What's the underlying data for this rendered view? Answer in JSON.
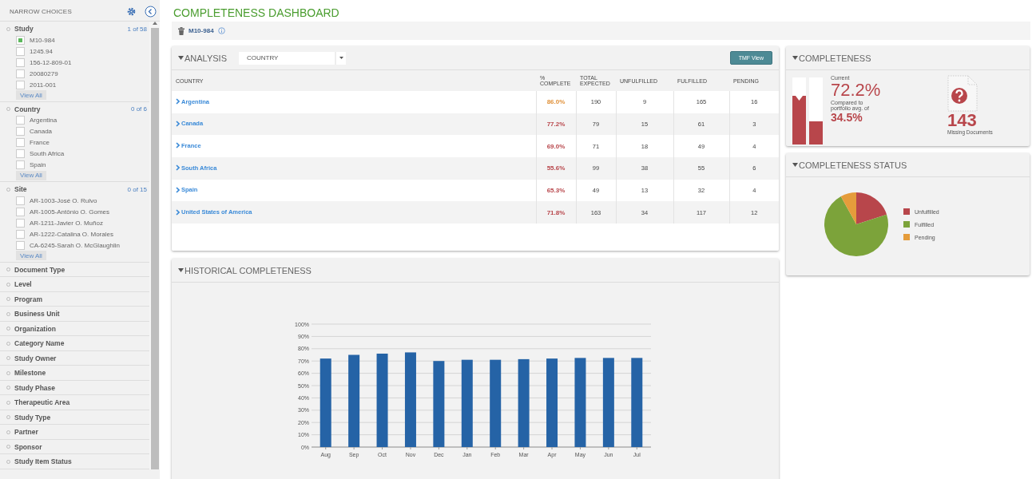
{
  "sidebar": {
    "title": "NARROW CHOICES",
    "facets": [
      {
        "name": "Study",
        "count": "1 of 58",
        "view_all": "View All",
        "items": [
          {
            "label": "M10-984",
            "checked": true
          },
          {
            "label": "1245.94",
            "checked": false
          },
          {
            "label": "156-12-809-01",
            "checked": false
          },
          {
            "label": "20080279",
            "checked": false
          },
          {
            "label": "2011-001",
            "checked": false
          }
        ]
      },
      {
        "name": "Country",
        "count": "0 of 6",
        "view_all": "View All",
        "items": [
          {
            "label": "Argentina",
            "checked": false
          },
          {
            "label": "Canada",
            "checked": false
          },
          {
            "label": "France",
            "checked": false
          },
          {
            "label": "South Africa",
            "checked": false
          },
          {
            "label": "Spain",
            "checked": false
          }
        ]
      },
      {
        "name": "Site",
        "count": "0 of 15",
        "view_all": "View All",
        "items": [
          {
            "label": "AR-1003-José O. Rulvo",
            "checked": false
          },
          {
            "label": "AR-1005-Antônio O. Gomes",
            "checked": false
          },
          {
            "label": "AR-1211-Javier O. Muñoz",
            "checked": false
          },
          {
            "label": "AR-1222-Catalina O. Morales",
            "checked": false
          },
          {
            "label": "CA-6245-Sarah O. McGlaughlin",
            "checked": false
          }
        ]
      },
      {
        "name": "Document Type"
      },
      {
        "name": "Level"
      },
      {
        "name": "Program"
      },
      {
        "name": "Business Unit"
      },
      {
        "name": "Organization"
      },
      {
        "name": "Category Name"
      },
      {
        "name": "Study Owner"
      },
      {
        "name": "Milestone"
      },
      {
        "name": "Study Phase"
      },
      {
        "name": "Therapeutic Area"
      },
      {
        "name": "Study Type"
      },
      {
        "name": "Partner"
      },
      {
        "name": "Sponsor"
      },
      {
        "name": "Study Item Status"
      }
    ]
  },
  "header": {
    "title": "COMPLETENESS DASHBOARD",
    "study": "M10-984"
  },
  "analysis": {
    "title": "ANALYSIS",
    "dimension": "COUNTRY",
    "button": "TMF View",
    "columns": [
      "COUNTRY",
      "% COMPLETE",
      "TOTAL EXPECTED",
      "UNFULFILLED",
      "FULFILLED",
      "PENDING"
    ],
    "rows": [
      {
        "country": "Argentina",
        "pct": "86.0%",
        "color": "#e0913a",
        "total": "190",
        "unfulfilled": "9",
        "fulfilled": "165",
        "pending": "16"
      },
      {
        "country": "Canada",
        "pct": "77.2%",
        "color": "#b8464b",
        "total": "79",
        "unfulfilled": "15",
        "fulfilled": "61",
        "pending": "3"
      },
      {
        "country": "France",
        "pct": "69.0%",
        "color": "#b8464b",
        "total": "71",
        "unfulfilled": "18",
        "fulfilled": "49",
        "pending": "4"
      },
      {
        "country": "South Africa",
        "pct": "55.6%",
        "color": "#b8464b",
        "total": "99",
        "unfulfilled": "38",
        "fulfilled": "55",
        "pending": "6"
      },
      {
        "country": "Spain",
        "pct": "65.3%",
        "color": "#b8464b",
        "total": "49",
        "unfulfilled": "13",
        "fulfilled": "32",
        "pending": "4"
      },
      {
        "country": "United States of America",
        "pct": "71.8%",
        "color": "#b8464b",
        "total": "163",
        "unfulfilled": "34",
        "fulfilled": "117",
        "pending": "12"
      }
    ]
  },
  "completeness": {
    "title": "COMPLETENESS",
    "bars": [
      {
        "level": 0.722
      },
      {
        "level": 0.345
      }
    ],
    "current_label": "Current",
    "current": "72.2%",
    "compared_label": "Compared to portfolio avg. of",
    "portfolio": "34.5%",
    "missing": "143",
    "missing_label": "Missing Documents"
  },
  "status": {
    "title": "COMPLETENESS STATUS",
    "legend": [
      {
        "label": "Unfulfilled",
        "color": "#b8464b"
      },
      {
        "label": "Fulfilled",
        "color": "#7ca33a"
      },
      {
        "label": "Pending",
        "color": "#e59c3b"
      }
    ]
  },
  "history": {
    "title": "HISTORICAL COMPLETENESS",
    "chart_data": {
      "type": "bar",
      "categories": [
        "Aug",
        "Sep",
        "Oct",
        "Nov",
        "Dec",
        "Jan",
        "Feb",
        "Mar",
        "Apr",
        "May",
        "Jun",
        "Jul"
      ],
      "values": [
        72,
        75,
        76,
        77,
        70,
        71,
        71,
        71.5,
        72,
        72.5,
        72.5,
        72.5
      ],
      "ylim": [
        0,
        100
      ],
      "grid": true,
      "yticks": [
        {
          "value": 0,
          "label": "0%"
        },
        {
          "value": 10,
          "label": "10%"
        },
        {
          "value": 20,
          "label": "20%"
        },
        {
          "value": 30,
          "label": "30%"
        },
        {
          "value": 40,
          "label": "40%"
        },
        {
          "value": 50,
          "label": "50%"
        },
        {
          "value": 60,
          "label": "60%"
        },
        {
          "value": 70,
          "label": "70%"
        },
        {
          "value": 80,
          "label": "80%"
        },
        {
          "value": 90,
          "label": "90%"
        },
        {
          "value": 100,
          "label": "100%"
        }
      ]
    }
  }
}
